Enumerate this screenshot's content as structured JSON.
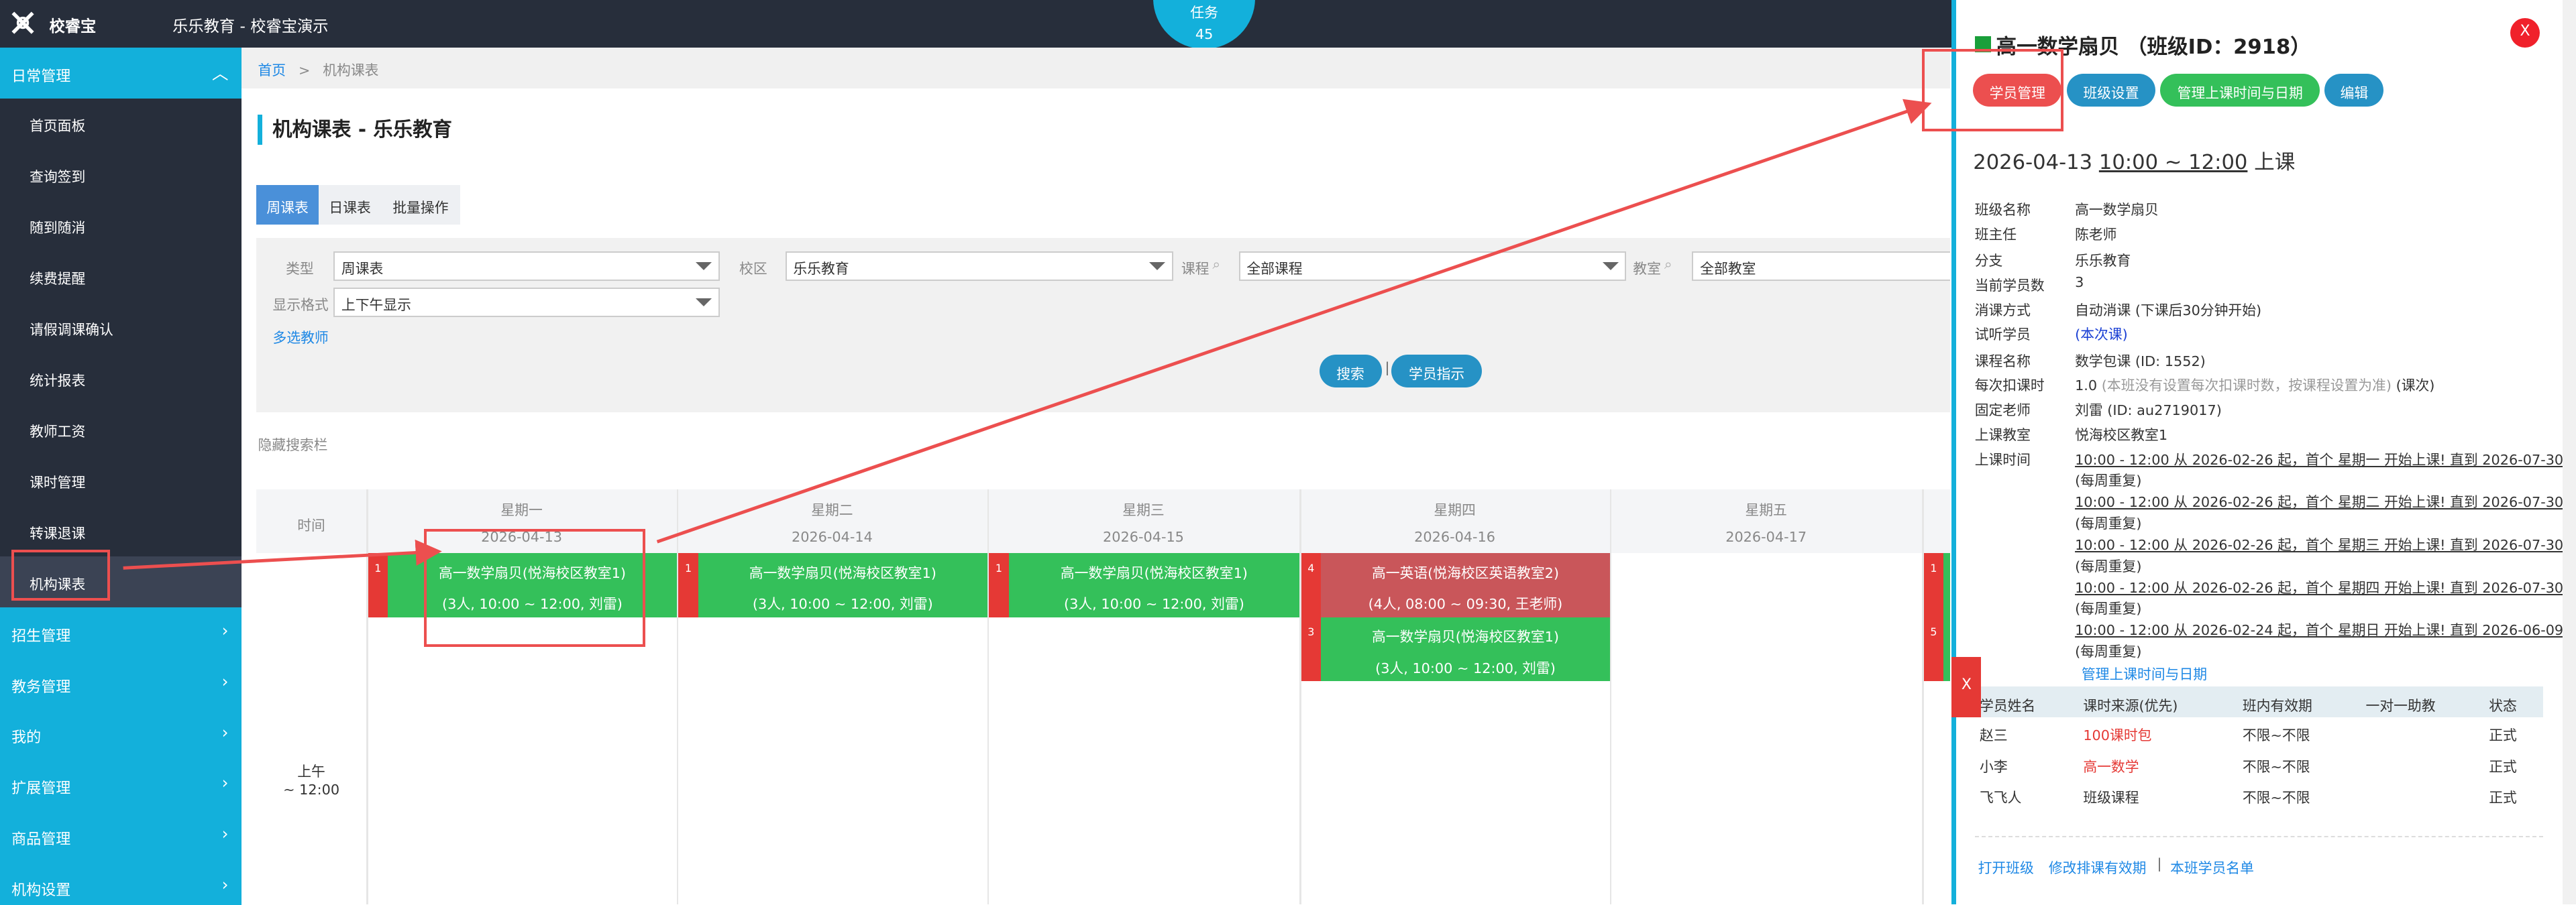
{
  "topbar": {
    "logo_text": "校睿宝",
    "app_title": "乐乐教育 - 校睿宝演示",
    "task_label": "任务",
    "task_count": "45"
  },
  "sidebar": {
    "sections": [
      {
        "label": "日常管理",
        "chevron": "up"
      },
      {
        "label": "招生管理",
        "chevron": "right"
      },
      {
        "label": "教务管理",
        "chevron": "right"
      },
      {
        "label": "我的",
        "chevron": "right"
      },
      {
        "label": "扩展管理",
        "chevron": "right"
      },
      {
        "label": "商品管理",
        "chevron": "right"
      },
      {
        "label": "机构设置",
        "chevron": "right"
      }
    ],
    "items": [
      "首页面板",
      "查询签到",
      "随到随消",
      "续费提醒",
      "请假调课确认",
      "统计报表",
      "教师工资",
      "课时管理",
      "转课退课",
      "机构课表"
    ],
    "active_item": "机构课表"
  },
  "breadcrumb": {
    "home": "首页",
    "sep": ">",
    "current": "机构课表"
  },
  "page_title": "机构课表 - 乐乐教育",
  "tabs": [
    "周课表",
    "日课表",
    "批量操作"
  ],
  "filters": {
    "type_label": "类型",
    "type_value": "周课表",
    "campus_label": "校区",
    "campus_value": "乐乐教育",
    "course_label": "课程",
    "course_value": "全部课程",
    "room_label": "教室",
    "room_value": "全部教室",
    "format_label": "显示格式",
    "format_value": "上下午显示",
    "multi_teacher": "多选教师",
    "search_btn": "搜索",
    "student_btn": "学员指示"
  },
  "hide_search": "隐藏搜索栏",
  "schedule": {
    "time_header": "时间",
    "days": [
      {
        "name": "星期一",
        "date": "2026-04-13"
      },
      {
        "name": "星期二",
        "date": "2026-04-14"
      },
      {
        "name": "星期三",
        "date": "2026-04-15"
      },
      {
        "name": "星期四",
        "date": "2026-04-16"
      },
      {
        "name": "星期五",
        "date": "2026-04-17"
      }
    ],
    "slot_label": "上午",
    "slot_time": "~ 12:00",
    "courses": [
      {
        "day": 0,
        "row": 0,
        "idx": "1",
        "title": "高一数学扇贝(悦海校区教室1)",
        "info": "(3人, 10:00 ~ 12:00, 刘雷)",
        "color": "#34c05a"
      },
      {
        "day": 1,
        "row": 0,
        "idx": "1",
        "title": "高一数学扇贝(悦海校区教室1)",
        "info": "(3人, 10:00 ~ 12:00, 刘雷)",
        "color": "#34c05a"
      },
      {
        "day": 2,
        "row": 0,
        "idx": "1",
        "title": "高一数学扇贝(悦海校区教室1)",
        "info": "(3人, 10:00 ~ 12:00, 刘雷)",
        "color": "#34c05a"
      },
      {
        "day": 3,
        "row": 0,
        "idx": "4",
        "title": "高一英语(悦海校区英语教室2)",
        "info": "(4人, 08:00 ~ 09:30, 王老师)",
        "color": "#c9565a"
      },
      {
        "day": 3,
        "row": 1,
        "idx": "3",
        "title": "高一数学扇贝(悦海校区教室1)",
        "info": "(3人, 10:00 ~ 12:00, 刘雷)",
        "color": "#34c05a"
      }
    ],
    "edge_marks": [
      "1",
      "5"
    ]
  },
  "panel": {
    "title": "高一数学扇贝 （班级ID：2918）",
    "close": "X",
    "buttons": [
      "学员管理",
      "班级设置",
      "管理上课时间与日期",
      "编辑"
    ],
    "session_date": "2026-04-13",
    "session_time": "10:00 ~ 12:00",
    "session_suffix": "上课",
    "fields": [
      {
        "label": "班级名称",
        "value": "高一数学扇贝"
      },
      {
        "label": "班主任",
        "value": "陈老师"
      },
      {
        "label": "分支",
        "value": "乐乐教育"
      },
      {
        "label": "当前学员数",
        "value": "3"
      },
      {
        "label": "消课方式",
        "value": "自动消课 (下课后30分钟开始)"
      },
      {
        "label": "试听学员",
        "value": "(本次课)"
      },
      {
        "label": "课程名称",
        "value": "数学包课 (ID: 1552)"
      },
      {
        "label": "每次扣课时",
        "value": "1.0",
        "note": "(本班没有设置每次扣课时数，按课程设置为准)",
        "suffix": "(课次)"
      },
      {
        "label": "固定老师",
        "value": "刘雷 (ID: au2719017)"
      },
      {
        "label": "上课教室",
        "value": "悦海校区教室1"
      },
      {
        "label": "上课时间",
        "value": ""
      }
    ],
    "schedule_lines": [
      {
        "line": "10:00 - 12:00 从 2026-02-26 起，首个 星期一 开始上课! 直到 2026-07-30",
        "repeat": "(每周重复)"
      },
      {
        "line": "10:00 - 12:00 从 2026-02-26 起，首个 星期二 开始上课! 直到 2026-07-30",
        "repeat": "(每周重复)"
      },
      {
        "line": "10:00 - 12:00 从 2026-02-26 起，首个 星期三 开始上课! 直到 2026-07-30",
        "repeat": "(每周重复)"
      },
      {
        "line": "10:00 - 12:00 从 2026-02-26 起，首个 星期四 开始上课! 直到 2026-07-30",
        "repeat": "(每周重复)"
      },
      {
        "line": "10:00 - 12:00 从 2026-02-24 起，首个 星期日 开始上课! 直到 2026-06-09",
        "repeat": "(每周重复)"
      }
    ],
    "manage_link": "管理上课时间与日期",
    "table_headers": [
      "学员姓名",
      "课时来源(优先)",
      "班内有效期",
      "一对一助教",
      "状态"
    ],
    "students": [
      {
        "name": "赵三",
        "source": "100课时包",
        "source_red": true,
        "valid": "不限~不限",
        "assist": "",
        "status": "正式"
      },
      {
        "name": "小李",
        "source": "高一数学",
        "source_red": true,
        "valid": "不限~不限",
        "assist": "",
        "status": "正式"
      },
      {
        "name": "飞飞人",
        "source": "班级课程",
        "source_red": false,
        "valid": "不限~不限",
        "assist": "",
        "status": "正式"
      }
    ],
    "footer_links": [
      "打开班级",
      "修改排课有效期",
      "本班学员名单"
    ],
    "side_x": "X"
  }
}
